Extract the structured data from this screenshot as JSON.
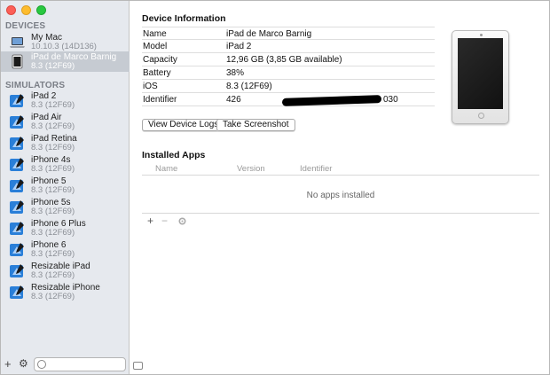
{
  "sidebar": {
    "devices_title": "DEVICES",
    "devices": [
      {
        "name": "My Mac",
        "sub": "10.10.3 (14D136)",
        "icon": "laptop-icon",
        "selected": false
      },
      {
        "name": "iPad de Marco Barnig",
        "sub": "8.3 (12F69)",
        "icon": "ipad-icon",
        "selected": true
      }
    ],
    "simulators_title": "SIMULATORS",
    "simulators": [
      {
        "name": "iPad 2",
        "sub": "8.3 (12F69)"
      },
      {
        "name": "iPad Air",
        "sub": "8.3 (12F69)"
      },
      {
        "name": "iPad Retina",
        "sub": "8.3 (12F69)"
      },
      {
        "name": "iPhone 4s",
        "sub": "8.3 (12F69)"
      },
      {
        "name": "iPhone 5",
        "sub": "8.3 (12F69)"
      },
      {
        "name": "iPhone 5s",
        "sub": "8.3 (12F69)"
      },
      {
        "name": "iPhone 6 Plus",
        "sub": "8.3 (12F69)"
      },
      {
        "name": "iPhone 6",
        "sub": "8.3 (12F69)"
      },
      {
        "name": "Resizable iPad",
        "sub": "8.3 (12F69)"
      },
      {
        "name": "Resizable iPhone",
        "sub": "8.3 (12F69)"
      }
    ],
    "add_label": "+",
    "gear_label": "⚙"
  },
  "device_info": {
    "title": "Device Information",
    "rows": [
      {
        "key": "Name",
        "value": "iPad de Marco Barnig"
      },
      {
        "key": "Model",
        "value": "iPad 2"
      },
      {
        "key": "Capacity",
        "value": "12,96 GB (3,85 GB available)"
      },
      {
        "key": "Battery",
        "value": "38%"
      },
      {
        "key": "iOS",
        "value": "8.3 (12F69)"
      },
      {
        "key": "Identifier",
        "value": "426",
        "value_tail": "030"
      }
    ],
    "logs_button": "View Device Logs",
    "screenshot_button": "Take Screenshot"
  },
  "installed_apps": {
    "title": "Installed Apps",
    "columns": [
      "Name",
      "Version",
      "Identifier"
    ],
    "empty_text": "No apps installed",
    "add_label": "+",
    "remove_label": "−"
  },
  "colors": {
    "selection": "#c6cbd2",
    "sidebar_bg": "#e6e9ee",
    "simulator_icon": "#2a7fd8"
  }
}
